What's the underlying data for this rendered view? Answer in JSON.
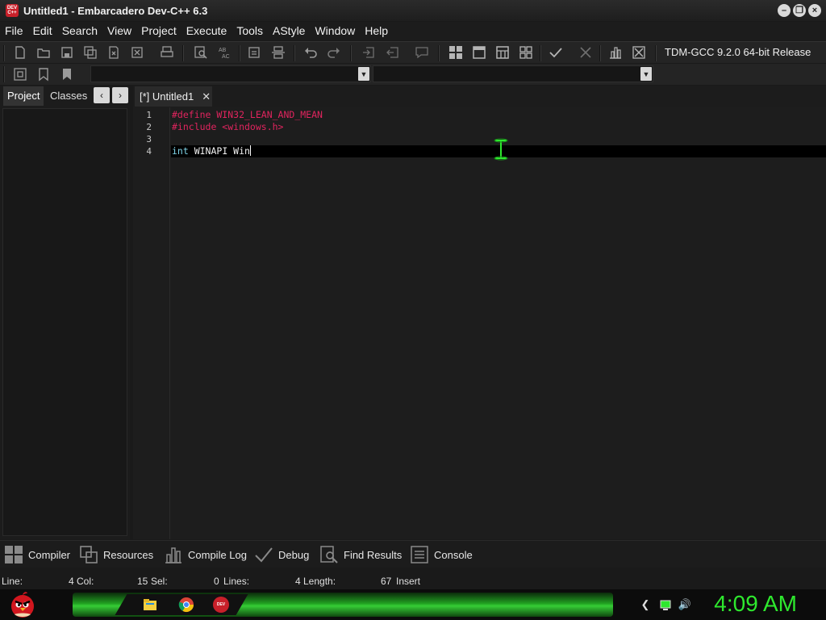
{
  "window": {
    "icon_text": "DEV C++",
    "title": "Untitled1 - Embarcadero Dev-C++ 6.3",
    "controls": [
      "minimize",
      "restore",
      "close"
    ]
  },
  "menu": [
    "File",
    "Edit",
    "Search",
    "View",
    "Project",
    "Execute",
    "Tools",
    "AStyle",
    "Window",
    "Help"
  ],
  "toolbar": {
    "compiler": "TDM-GCC 9.2.0 64-bit Release",
    "icons": [
      "new-file-icon",
      "open-folder-icon",
      "save-icon",
      "save-all-icon",
      "close-file-icon",
      "close-all-icon",
      "print-icon",
      "find-icon",
      "replace-icon",
      "goto-icon",
      "split-icon",
      "undo-icon",
      "redo-icon",
      "indent-icon",
      "unindent-icon",
      "comment-icon",
      "grid-icon",
      "window-icon",
      "layout-icon",
      "tiles-icon",
      "check-icon",
      "stop-icon",
      "chart-icon",
      "rebuild-icon"
    ]
  },
  "left_panel": {
    "tabs": [
      "Project",
      "Classes"
    ],
    "active_tab": "Project"
  },
  "editor": {
    "tab_label": "[*] Untitled1",
    "lines": [
      {
        "num": "1",
        "text": "#define WIN32_LEAN_AND_MEAN",
        "kind": "preprocessor"
      },
      {
        "num": "2",
        "text": "#include <windows.h>",
        "kind": "preprocessor"
      },
      {
        "num": "3",
        "text": "",
        "kind": "plain"
      },
      {
        "num": "4",
        "kw": "int",
        "text": " WINAPI Win",
        "kind": "code"
      }
    ],
    "current_line": 4
  },
  "bottom_tabs": [
    {
      "label": "Compiler",
      "icon": "grid-icon"
    },
    {
      "label": "Resources",
      "icon": "resources-icon"
    },
    {
      "label": "Compile Log",
      "icon": "chart-icon"
    },
    {
      "label": "Debug",
      "icon": "check-icon"
    },
    {
      "label": "Find Results",
      "icon": "find-icon"
    },
    {
      "label": "Console",
      "icon": "console-icon"
    }
  ],
  "status": {
    "line_label": "Line:",
    "line_value": "4",
    "col_label": "Col:",
    "col_value": "15",
    "sel_label": "Sel:",
    "sel_value": "0",
    "lines_label": "Lines:",
    "lines_value": "4",
    "length_label": "Length:",
    "length_value": "67",
    "mode": "Insert"
  },
  "taskbar": {
    "clock": "4:09 AM",
    "pinned": [
      "file-explorer-icon",
      "chrome-icon",
      "devcpp-icon"
    ]
  },
  "colors": {
    "preprocessor": "#e0245e",
    "keyword": "#7fd4e8",
    "clock": "#2ee82e"
  }
}
